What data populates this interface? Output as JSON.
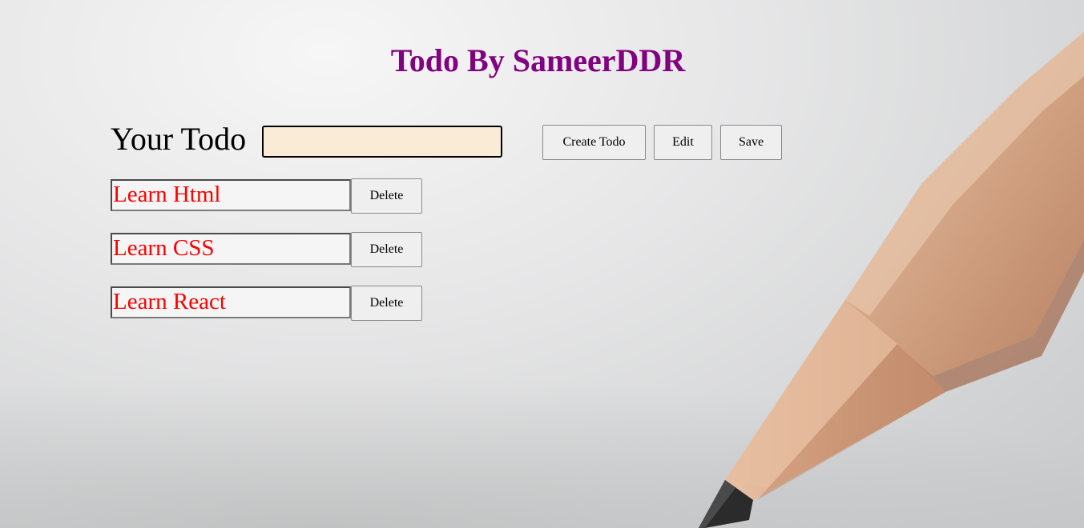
{
  "app": {
    "title": "Todo By SameerDDR"
  },
  "form": {
    "label": "Your Todo",
    "input_value": "",
    "input_placeholder": "",
    "buttons": {
      "create": "Create Todo",
      "edit": "Edit",
      "save": "Save"
    }
  },
  "todos": [
    {
      "text": "Learn Html",
      "delete_label": "Delete"
    },
    {
      "text": "Learn CSS",
      "delete_label": "Delete"
    },
    {
      "text": "Learn React",
      "delete_label": "Delete"
    }
  ],
  "colors": {
    "title": "#800080",
    "todo_text": "#ff0000",
    "input_background": "#faebd7"
  },
  "background": {
    "image_subject": "pencil-icon"
  }
}
